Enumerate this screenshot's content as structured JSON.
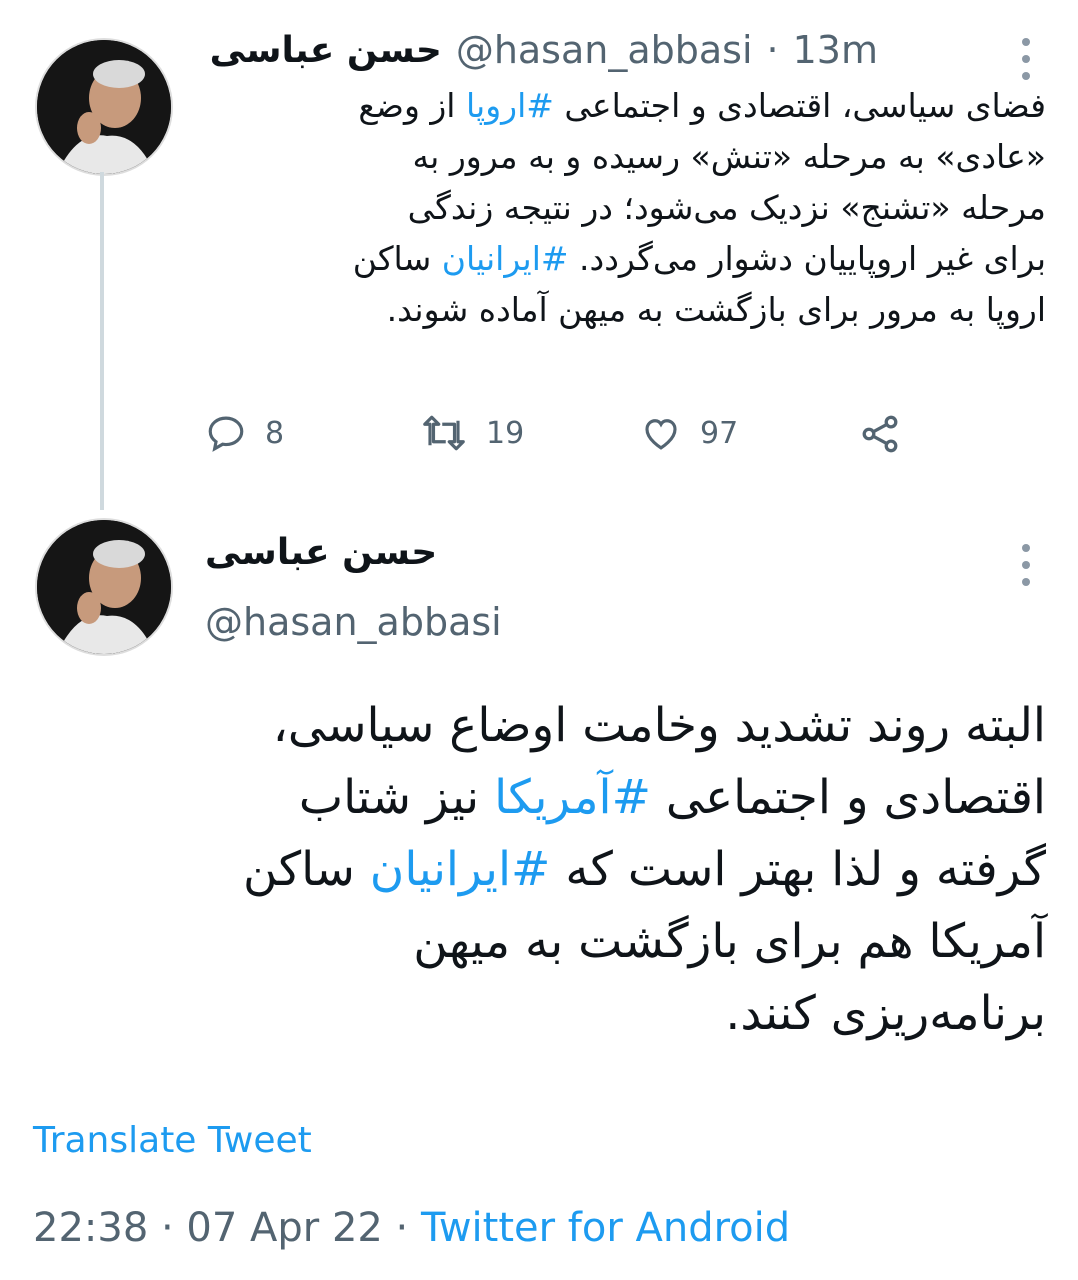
{
  "tweet1": {
    "author_name": "حسن عباسی",
    "handle": "@hasan_abbasi",
    "separator": "·",
    "time": "13m",
    "text_lines": [
      [
        "فضای سیاسی، اقتصادی و اجتماعی ",
        "#اروپا",
        " از وضع"
      ],
      [
        "«عادی» به مرحله «تنش» رسیده و به مرور به"
      ],
      [
        "مرحله «تشنج» نزدیک می‌شود؛ در نتیجه زندگی"
      ],
      [
        "برای غیر اروپاییان دشوار می‌گردد. ",
        "#ایرانیان",
        " ساکن"
      ],
      [
        "اروپا به مرور برای بازگشت به میهن آماده شوند."
      ]
    ],
    "replies": "8",
    "retweets": "19",
    "likes": "97",
    "icons": [
      "reply-icon",
      "retweet-icon",
      "like-icon",
      "share-icon",
      "more-icon"
    ]
  },
  "tweet2": {
    "author_name": "حسن عباسی",
    "handle": "@hasan_abbasi",
    "text_lines": [
      [
        "البته روند تشدید وخامت اوضاع سیاسی،"
      ],
      [
        "اقتصادی و اجتماعی ",
        "#آمریکا",
        " نیز شتاب"
      ],
      [
        "گرفته و لذا بهتر است که ",
        "#ایرانیان",
        " ساکن"
      ],
      [
        "آمریکا هم برای بازگشت به میهن"
      ],
      [
        "برنامه‌ریزی کنند."
      ]
    ],
    "translate_label": "Translate Tweet",
    "timestamp": "22:38 · 07 Apr 22 · ",
    "source": "Twitter for Android"
  },
  "colors": {
    "link": "#1d9bf0",
    "secondary_text": "#536471",
    "primary_text": "#0f1419",
    "thread_line": "#cfd9de"
  }
}
